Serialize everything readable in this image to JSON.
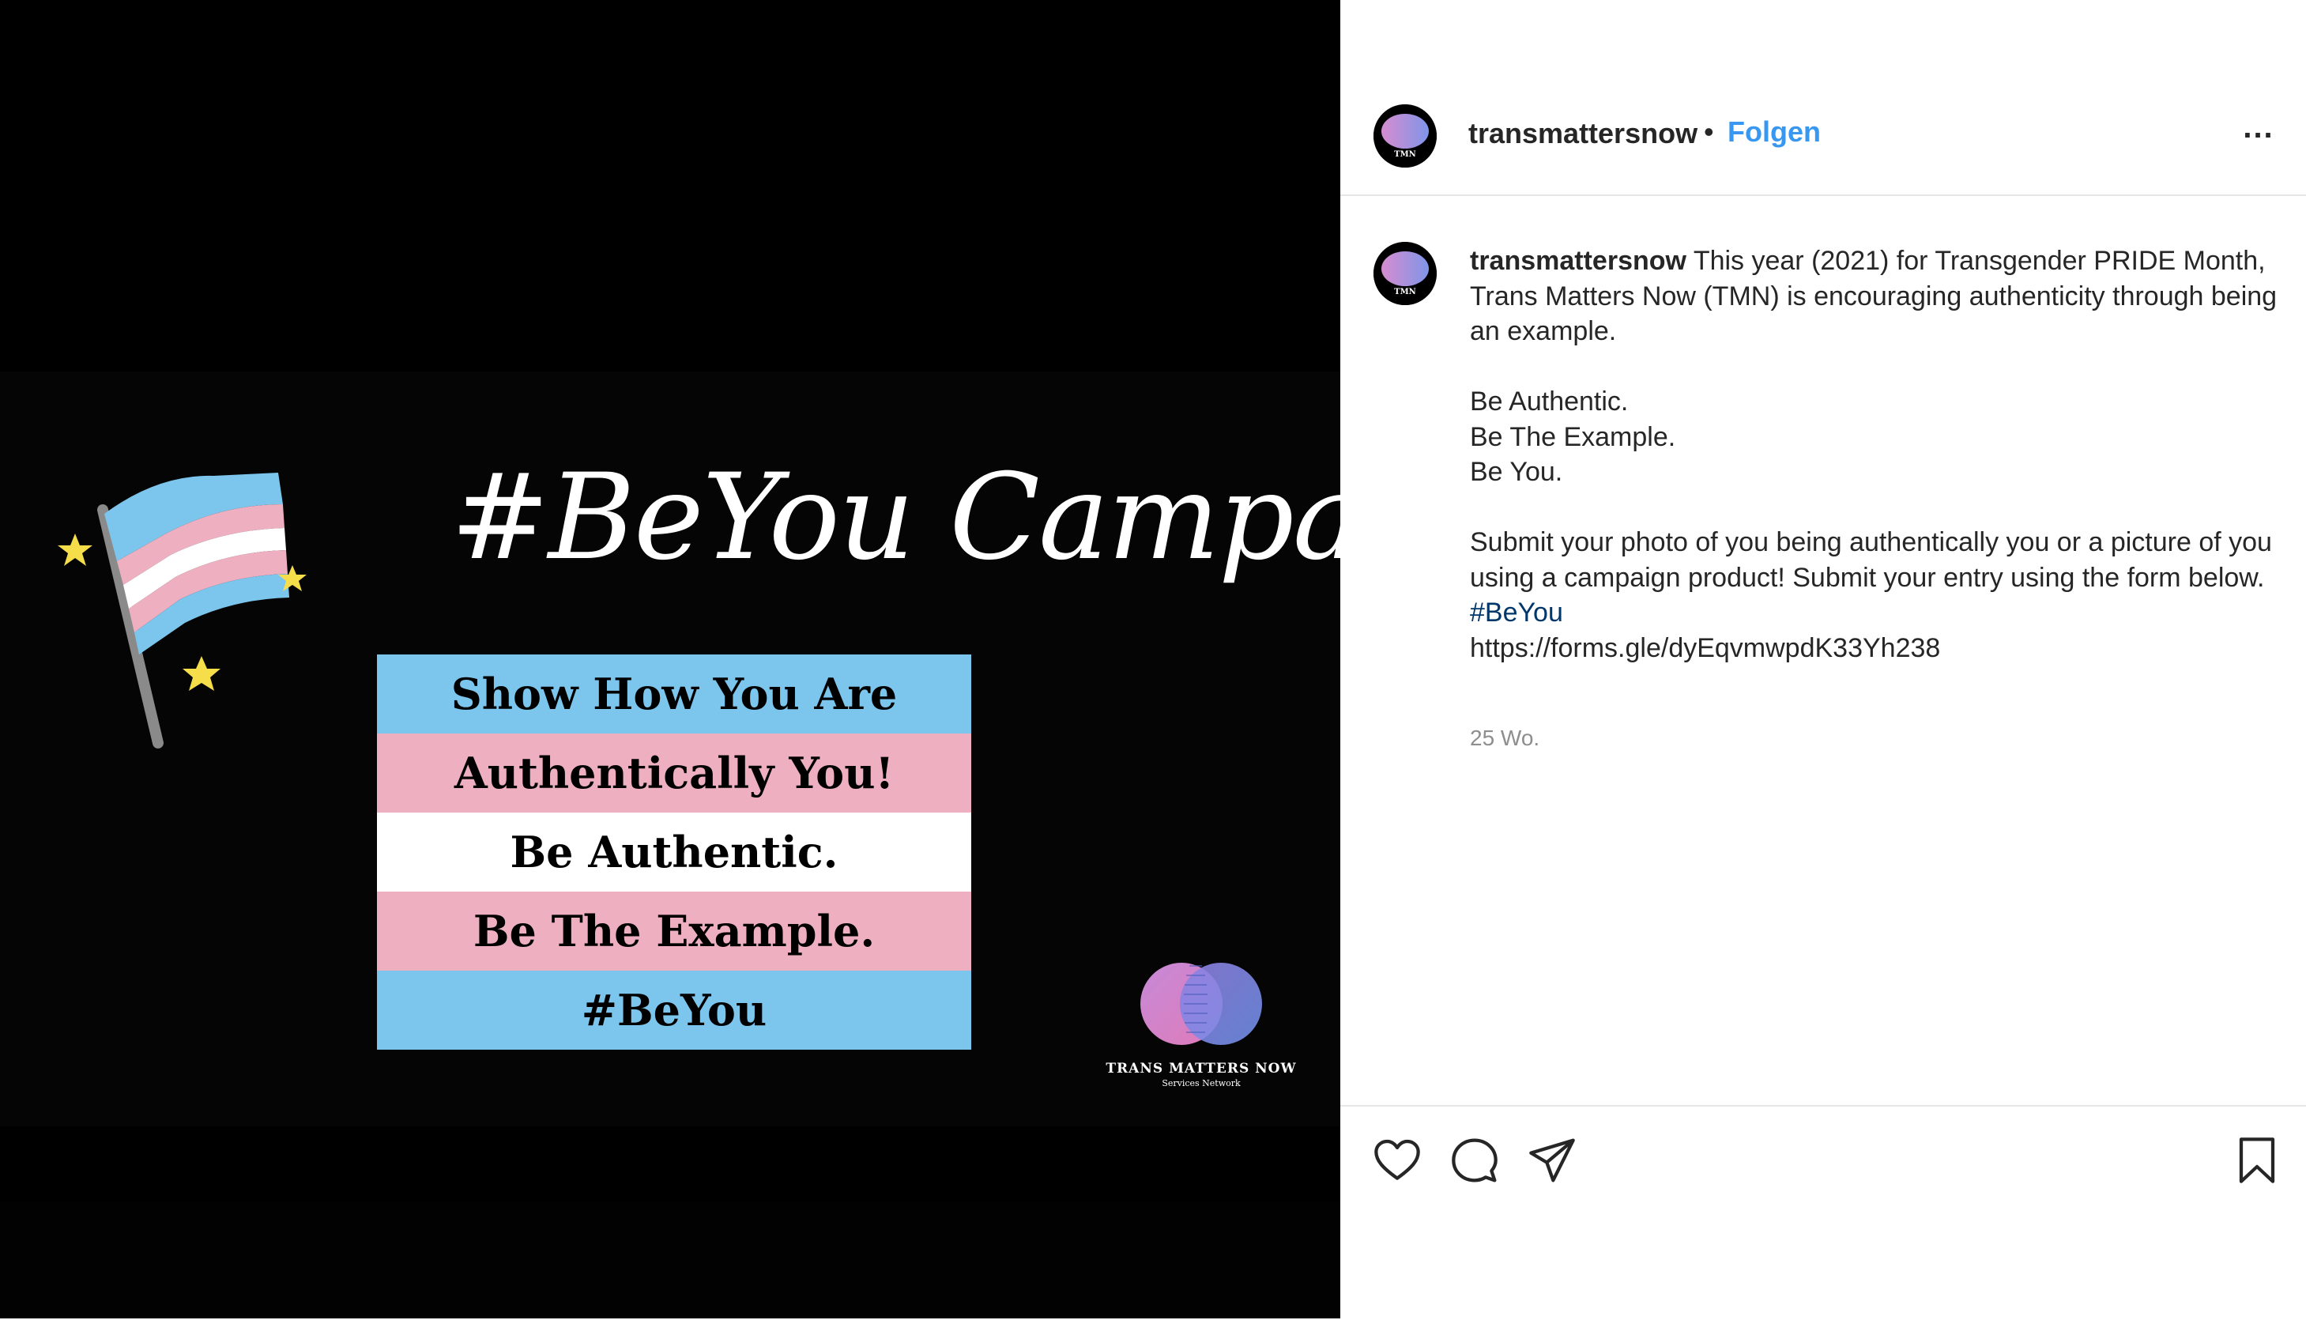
{
  "media": {
    "campaign_title": "#BeYou Campaign",
    "stripes": [
      "Show How You Are",
      "Authentically You!",
      "Be Authentic.",
      "Be The Example.",
      "#BeYou"
    ],
    "logo_name": "TRANS MATTERS NOW",
    "logo_sub": "Services Network",
    "avatar_text": "TMN",
    "colors": {
      "trans_blue": "#7cc6ee",
      "trans_pink": "#eeb0c0",
      "star": "#f6dd4a"
    }
  },
  "header": {
    "username": "transmattersnow",
    "separator": "•",
    "follow_label": "Folgen",
    "more_label": "..."
  },
  "caption": {
    "username": "transmattersnow",
    "intro": "This year (2021) for Transgender PRIDE Month, Trans Matters Now (TMN) is encouraging authenticity through being an example.",
    "lines": [
      "Be Authentic.",
      "Be The Example.",
      "Be You."
    ],
    "submit": "Submit your photo of you being authentically you or a picture of you using a campaign product! Submit your entry using the form below.",
    "hashtag": "#BeYou",
    "link": "https://forms.gle/dyEqvmwpdK33Yh238",
    "time": "25 Wo."
  },
  "actions": {
    "like_icon": "heart-icon",
    "comment_icon": "comment-icon",
    "share_icon": "paper-plane-icon",
    "save_icon": "bookmark-icon"
  },
  "theme": {
    "link_blue": "#3897f0",
    "hashtag_blue": "#00376b",
    "text": "#262626",
    "muted": "#8e8e8e"
  }
}
